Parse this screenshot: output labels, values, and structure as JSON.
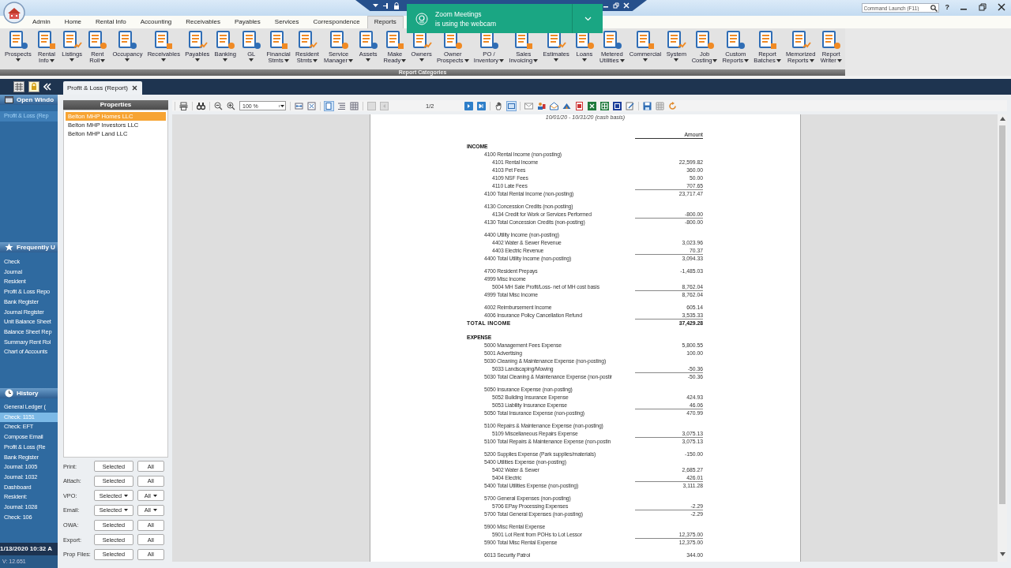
{
  "title_bar": {
    "command_placeholder": "Command Launch (F11)",
    "help": "?"
  },
  "notification": {
    "title": "Zoom Meetings",
    "message": "is using the webcam"
  },
  "menu_tabs": [
    {
      "label": "Admin",
      "selected": false
    },
    {
      "label": "Home",
      "selected": false
    },
    {
      "label": "Rental Info",
      "selected": false
    },
    {
      "label": "Accounting",
      "selected": false
    },
    {
      "label": "Receivables",
      "selected": false
    },
    {
      "label": "Payables",
      "selected": false
    },
    {
      "label": "Services",
      "selected": false
    },
    {
      "label": "Correspondence",
      "selected": false
    },
    {
      "label": "Reports",
      "selected": true
    }
  ],
  "ribbon": {
    "group_label": "Report Categories",
    "items": [
      {
        "lines": [
          "Prospects"
        ],
        "menu": true
      },
      {
        "lines": [
          "Rental",
          "Info"
        ],
        "menu": true
      },
      {
        "lines": [
          "Listings"
        ],
        "menu": true
      },
      {
        "lines": [
          "Rent",
          "Roll"
        ],
        "menu": true
      },
      {
        "lines": [
          "Occupancy"
        ],
        "menu": true
      },
      {
        "lines": [
          "Receivables"
        ],
        "menu": true
      },
      {
        "lines": [
          "Payables"
        ],
        "menu": true
      },
      {
        "lines": [
          "Banking"
        ],
        "menu": true
      },
      {
        "lines": [
          "GL"
        ],
        "menu": true
      },
      {
        "lines": [
          "Financial",
          "Stmts"
        ],
        "menu": true
      },
      {
        "lines": [
          "Resident",
          "Stmts"
        ],
        "menu": true
      },
      {
        "lines": [
          "Service",
          "Manager"
        ],
        "menu": true
      },
      {
        "lines": [
          "Assets"
        ],
        "menu": true
      },
      {
        "lines": [
          "Make",
          "Ready"
        ],
        "menu": true
      },
      {
        "lines": [
          "Owners"
        ],
        "menu": true
      },
      {
        "lines": [
          "Owner",
          "Prospects"
        ],
        "menu": true
      },
      {
        "lines": [
          "PO /",
          "Inventory"
        ],
        "menu": true
      },
      {
        "lines": [
          "Sales",
          "Invoicing"
        ],
        "menu": true
      },
      {
        "lines": [
          "Estimates"
        ],
        "menu": true
      },
      {
        "lines": [
          "Loans"
        ],
        "menu": true
      },
      {
        "lines": [
          "Metered",
          "Utilities"
        ],
        "menu": true
      },
      {
        "lines": [
          "Commercial"
        ],
        "menu": true
      },
      {
        "lines": [
          "System"
        ],
        "menu": true
      },
      {
        "lines": [
          "Job",
          "Costing"
        ],
        "menu": true
      },
      {
        "lines": [
          "Custom",
          "Reports"
        ],
        "menu": true
      },
      {
        "lines": [
          "Report",
          "Batches"
        ],
        "menu": true
      },
      {
        "lines": [
          "Memorized",
          "Reports"
        ],
        "menu": true
      },
      {
        "lines": [
          "Report",
          "Writer"
        ],
        "menu": true
      }
    ]
  },
  "sidebar": {
    "open_windows": {
      "title": "Open Windo",
      "items": [
        {
          "label": "Profit & Loss (Rep",
          "selected": true
        }
      ]
    },
    "frequently_used": {
      "title": "Frequently U",
      "items": [
        {
          "label": "Check"
        },
        {
          "label": "Journal"
        },
        {
          "label": "Resident"
        },
        {
          "label": "Profit & Loss Repo"
        },
        {
          "label": "Bank Register"
        },
        {
          "label": "Journal Register"
        },
        {
          "label": "Unit Balance Sheet"
        },
        {
          "label": "Balance Sheet Rep"
        },
        {
          "label": "Summary Rent Rol"
        },
        {
          "label": "Chart of Accounts"
        }
      ]
    },
    "history": {
      "title": "History",
      "items": [
        {
          "label": "General Ledger (",
          "selected": false
        },
        {
          "label": "Check: 1151",
          "selected": true
        },
        {
          "label": "Check: EFT",
          "selected": false
        },
        {
          "label": "Compose Email",
          "selected": false
        },
        {
          "label": "Profit & Loss (Re",
          "selected": false
        },
        {
          "label": "Bank Register",
          "selected": false
        },
        {
          "label": "Journal: 1005",
          "selected": false
        },
        {
          "label": "Journal: 1032",
          "selected": false
        },
        {
          "label": "Dashboard",
          "selected": false
        },
        {
          "label": "Resident:",
          "selected": false
        },
        {
          "label": "Journal: 1028",
          "selected": false
        },
        {
          "label": "Check: 106",
          "selected": false
        }
      ]
    },
    "datetime": "1/13/2020 10:32 A",
    "version": "V: 12.651"
  },
  "document_tab": {
    "label": "Profit & Loss (Report)"
  },
  "properties": {
    "title": "Properties",
    "items": [
      {
        "label": "Belton MHP Homes LLC",
        "selected": true
      },
      {
        "label": "Belton MHP Investors LLC",
        "selected": false
      },
      {
        "label": "Belton MHP Land LLC",
        "selected": false
      }
    ],
    "actions": [
      {
        "label": "Print:",
        "kind": "plain",
        "selected_button": "Selected",
        "all_button": "All"
      },
      {
        "label": "Attach:",
        "kind": "plain",
        "selected_button": "Selected",
        "all_button": "All"
      },
      {
        "label": "VPO:",
        "kind": "dropdown",
        "selected_button": "Selected",
        "all_button": "All"
      },
      {
        "label": "Email:",
        "kind": "dropdown",
        "selected_button": "Selected",
        "all_button": "All"
      },
      {
        "label": "OWA:",
        "kind": "plain",
        "selected_button": "Selected",
        "all_button": "All"
      },
      {
        "label": "Export:",
        "kind": "plain",
        "selected_button": "Selected",
        "all_button": "All"
      },
      {
        "label": "Prop Files:",
        "kind": "plain",
        "selected_button": "Selected",
        "all_button": "All"
      }
    ]
  },
  "viewer": {
    "zoom": "100 %",
    "page": "1/2"
  },
  "report": {
    "subtitle": "10/01/20 - 10/31/20 (cash basis)",
    "amount_header": "Amount",
    "sections": [
      {
        "heading": "INCOME",
        "entries": [
          {
            "kind": "group",
            "label": "4100 Rental Income (non-posting)",
            "children": [
              {
                "label": "4101 Rental Income",
                "amount": "22,599.82"
              },
              {
                "label": "4103 Pet Fees",
                "amount": "360.00"
              },
              {
                "label": "4109 NSF Fees",
                "amount": "50.00"
              },
              {
                "label": "4110 Late Fees",
                "amount": "707.65"
              }
            ],
            "total": {
              "label": "4100 Total Rental Income (non-posting)",
              "amount": "23,717.47"
            }
          },
          {
            "kind": "group",
            "label": "4130 Concession Credits (non-posting)",
            "children": [
              {
                "label": "4134 Credit for Work or Services Performed",
                "amount": "-800.00"
              }
            ],
            "total": {
              "label": "4130 Total Concession Credits (non-posting)",
              "amount": "-800.00"
            }
          },
          {
            "kind": "group",
            "label": "4400 Utility Income (non-posting)",
            "children": [
              {
                "label": "4402 Water & Sewer Revenue",
                "amount": "3,023.96"
              },
              {
                "label": "4403 Electric Revenue",
                "amount": "70.37"
              }
            ],
            "total": {
              "label": "4400 Total Utility Income (non-posting)",
              "amount": "3,094.33"
            }
          },
          {
            "kind": "item",
            "label": "4700 Resident Prepays",
            "amount": "-1,485.03"
          },
          {
            "kind": "group",
            "label": "4999 Misc Income",
            "children": [
              {
                "label": "5004 MH Sale Profit/Loss- net of MH cost basis",
                "amount": "8,762.04"
              }
            ],
            "total": {
              "label": "4999 Total Misc Income",
              "amount": "8,762.04"
            }
          },
          {
            "kind": "item",
            "label": "4002 Reimbursement Income",
            "amount": "605.14"
          },
          {
            "kind": "item",
            "label": "4006 Insurance Policy Cancellation Refund",
            "amount": "3,535.33"
          }
        ],
        "total": {
          "label": "TOTAL INCOME",
          "amount": "37,429.28"
        }
      },
      {
        "heading": "EXPENSE",
        "entries": [
          {
            "kind": "item",
            "label": "5000 Management Fees Expense",
            "amount": "5,800.55"
          },
          {
            "kind": "item",
            "label": "5001 Advertising",
            "amount": "100.00"
          },
          {
            "kind": "group",
            "label": "5030 Cleaning & Maintenance Expense (non-posting)",
            "children": [
              {
                "label": "5033 Landscaping/Mowing",
                "amount": "-50.36"
              }
            ],
            "total": {
              "label": "5030 Total Cleaning & Maintenance Expense (non-postir",
              "amount": "-50.36"
            }
          },
          {
            "kind": "group",
            "label": "5050 Insurance Expense (non-posting)",
            "children": [
              {
                "label": "5052 Building Insurance Expense",
                "amount": "424.93"
              },
              {
                "label": "5053 Liability Insurance Expense",
                "amount": "46.06"
              }
            ],
            "total": {
              "label": "5050 Total Insurance Expense (non-posting)",
              "amount": "470.99"
            }
          },
          {
            "kind": "group",
            "label": "5100 Repairs & Maintenance Expense (non-posting)",
            "children": [
              {
                "label": "5109 Miscellaneous Repairs Expense",
                "amount": "3,075.13"
              }
            ],
            "total": {
              "label": "5100 Total Repairs & Maintenance Expense (non-postin",
              "amount": "3,075.13"
            }
          },
          {
            "kind": "item",
            "label": "5200 Supplies Expense (Park supplies/materials)",
            "amount": "-150.00"
          },
          {
            "kind": "group",
            "label": "5400 Utilities Expense (non-posting)",
            "children": [
              {
                "label": "5402 Water & Sewer",
                "amount": "2,685.27"
              },
              {
                "label": "5404 Electric",
                "amount": "426.01"
              }
            ],
            "total": {
              "label": "5400 Total Utilities Expense (non-posting)",
              "amount": "3,111.28"
            }
          },
          {
            "kind": "group",
            "label": "5700 General Expenses (non-posting)",
            "children": [
              {
                "label": "5706 EPay Processing Expenses",
                "amount": "-2.29"
              }
            ],
            "total": {
              "label": "5700 Total General Expenses (non-posting)",
              "amount": "-2.29"
            }
          },
          {
            "kind": "group",
            "label": "5900 Misc Rental Expense",
            "children": [
              {
                "label": "5901 Lot Rent from POHs to Lot Lessor",
                "amount": "12,375.00"
              }
            ],
            "total": {
              "label": "5900 Total Misc Rental Expense",
              "amount": "12,375.00"
            }
          },
          {
            "kind": "item",
            "label": "6013 Security Patrol",
            "amount": "344.00"
          }
        ]
      }
    ]
  }
}
